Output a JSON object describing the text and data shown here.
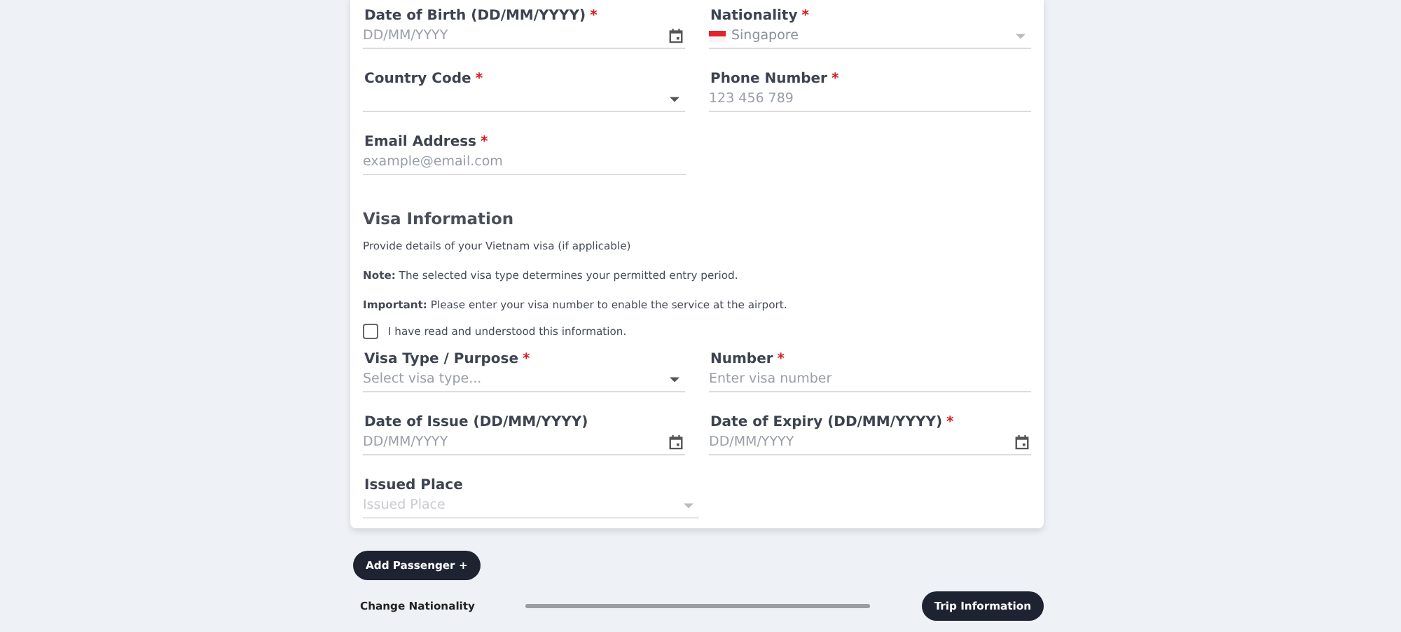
{
  "personal_rows": [
    [
      {
        "kind": "date",
        "label": "Date of Birth (DD/MM/YYYY)",
        "required_mark": "*",
        "placeholder": "DD/MM/YYYY",
        "disabled": false
      },
      {
        "kind": "country",
        "label": "Nationality",
        "required_mark": "*",
        "value": "Singapore",
        "disabled": false
      }
    ],
    [
      {
        "kind": "select",
        "label": "Country Code",
        "required_mark": "*",
        "disabled": false
      },
      {
        "kind": "text",
        "label": "Phone Number",
        "required_mark": "*",
        "placeholder": "123 456 789",
        "disabled": false
      }
    ],
    [
      {
        "kind": "text",
        "label": "Email Address",
        "required_mark": "*",
        "placeholder": "example@email.com",
        "disabled": false
      }
    ]
  ],
  "visa": {
    "heading": "Visa Information",
    "intro": "Provide details of your Vietnam visa (if applicable)",
    "notes": [
      "**Note:** The selected visa type determines your permitted entry period.",
      "**Important:** Please enter your visa number to enable the service at the airport."
    ],
    "acknowledge": {
      "label": "I have read and understood this information.",
      "checked": false
    },
    "rows": [
      [
        {
          "kind": "select",
          "label": "Visa Type / Purpose",
          "required_mark": "*",
          "placeholder": "Select visa type...",
          "disabled": false
        },
        {
          "kind": "text",
          "label": "Number",
          "required_mark": "*",
          "placeholder": "Enter visa number",
          "disabled": false
        }
      ],
      [
        {
          "kind": "date",
          "label": "Date of Issue (DD/MM/YYYY)",
          "placeholder": "DD/MM/YYYY",
          "disabled": false
        },
        {
          "kind": "date",
          "label": "Date of Expiry (DD/MM/YYYY)",
          "required_mark": "*",
          "placeholder": "DD/MM/YYYY",
          "disabled": false
        }
      ],
      [
        {
          "kind": "select",
          "label": "Issued Place",
          "placeholder": "Issued Place",
          "disabled": true
        }
      ]
    ]
  },
  "add_button": "Add Passenger +",
  "footer": {
    "back": "Change Nationality",
    "progress": {
      "level": 1
    },
    "next": "Trip Information"
  }
}
